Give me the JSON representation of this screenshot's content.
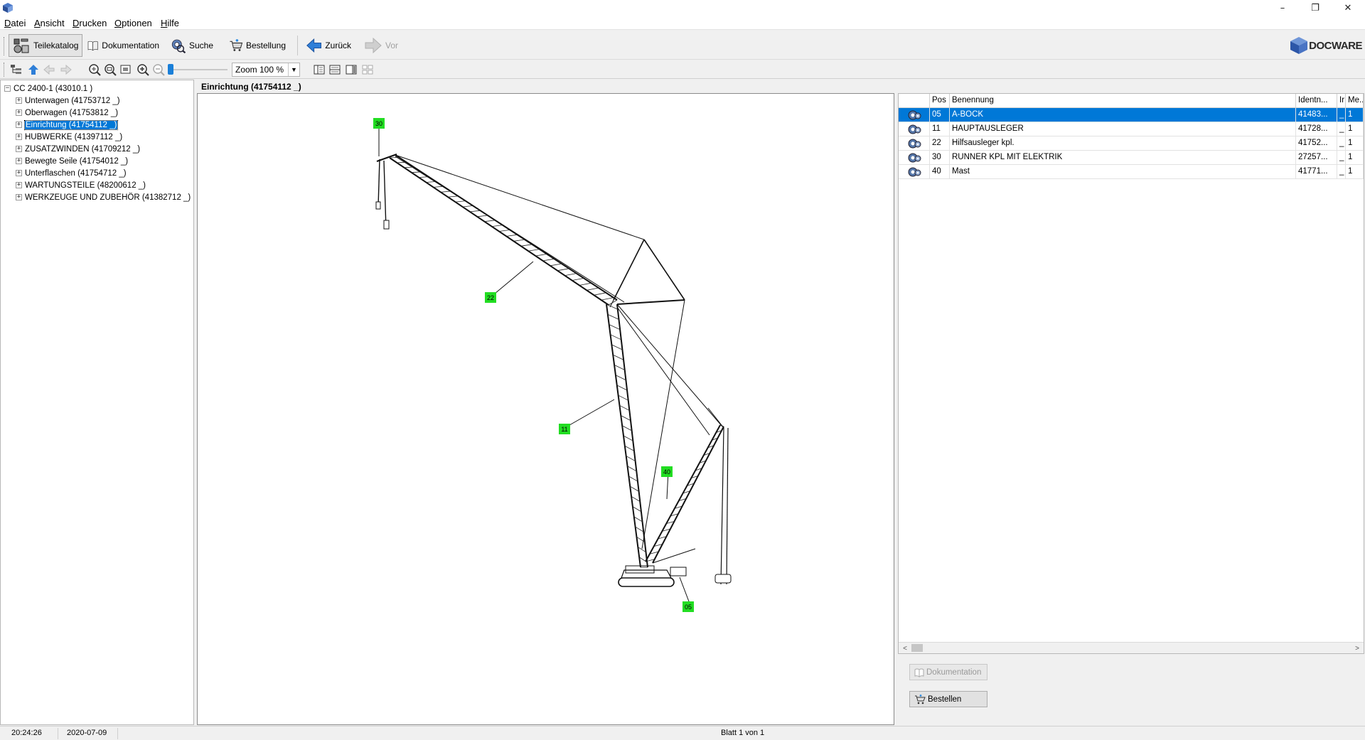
{
  "window": {
    "minimize": "–",
    "restore": "❐",
    "close": "✕"
  },
  "menu": [
    {
      "label": "Datei"
    },
    {
      "label": "Ansicht"
    },
    {
      "label": "Drucken"
    },
    {
      "label": "Optionen"
    },
    {
      "label": "Hilfe"
    }
  ],
  "toolbar": {
    "parts_catalog": "Teilekatalog",
    "documentation": "Dokumentation",
    "search": "Suche",
    "order": "Bestellung",
    "back": "Zurück",
    "forward": "Vor",
    "brand": "DOCWARE"
  },
  "toolbar2": {
    "zoom_value": "Zoom 100 %"
  },
  "tree": {
    "root": "CC 2400-1 (43010.1 )",
    "items": [
      {
        "label": "Unterwagen (41753712 _)"
      },
      {
        "label": "Oberwagen (41753812 _)"
      },
      {
        "label": "Einrichtung (41754112 _)",
        "selected": true
      },
      {
        "label": "HUBWERKE (41397112 _)"
      },
      {
        "label": "ZUSATZWINDEN (41709212 _)"
      },
      {
        "label": "Bewegte Seile (41754012 _)"
      },
      {
        "label": "Unterflaschen (41754712 _)"
      },
      {
        "label": "WARTUNGSTEILE (48200612 _)"
      },
      {
        "label": "WERKZEUGE UND ZUBEHÖR (41382712 _)"
      }
    ],
    "expander_symbol": "+",
    "root_expander_symbol": "−"
  },
  "drawing": {
    "title": "Einrichtung (41754112 _)",
    "callouts": [
      "30",
      "22",
      "11",
      "40",
      "05"
    ],
    "callout_color": "#22dd22"
  },
  "parts": {
    "headers": [
      "",
      "Pos",
      "Benennung",
      "Identn...",
      "Ir",
      "Me..."
    ],
    "rows": [
      {
        "pos": "05",
        "name": "A-BOCK",
        "ident": "41483...",
        "ir": "_",
        "qty": "1",
        "selected": true
      },
      {
        "pos": "11",
        "name": "HAUPTAUSLEGER",
        "ident": "41728...",
        "ir": "_",
        "qty": "1"
      },
      {
        "pos": "22",
        "name": "Hilfsausleger kpl.",
        "ident": "41752...",
        "ir": "_",
        "qty": "1"
      },
      {
        "pos": "30",
        "name": "RUNNER KPL MIT ELEKTRIK",
        "ident": "27257...",
        "ir": "_",
        "qty": "1"
      },
      {
        "pos": "40",
        "name": "Mast",
        "ident": "41771...",
        "ir": "_",
        "qty": "1"
      }
    ],
    "scroll_left": "<",
    "scroll_right": ">"
  },
  "actions": {
    "documentation": "Dokumentation",
    "order": "Bestellen"
  },
  "status": {
    "time": "20:24:26",
    "date": "2020-07-09",
    "sheet": "Blatt 1 von 1"
  },
  "colors": {
    "selection": "#0078d7",
    "callout": "#22dd22"
  }
}
